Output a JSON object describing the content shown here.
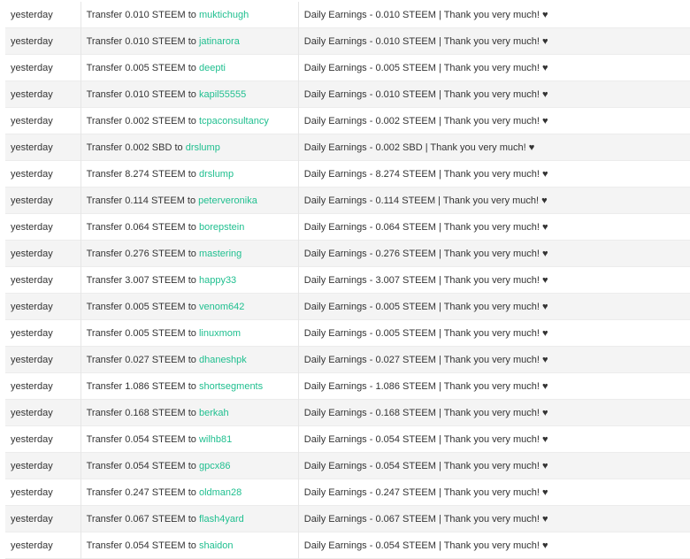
{
  "transfers": [
    {
      "when": "yesterday",
      "op_prefix": "Transfer 0.010 STEEM to",
      "to": "muktichugh",
      "memo": "Daily Earnings - 0.010 STEEM | Thank you very much! ♥"
    },
    {
      "when": "yesterday",
      "op_prefix": "Transfer 0.010 STEEM to",
      "to": "jatinarora",
      "memo": "Daily Earnings - 0.010 STEEM | Thank you very much! ♥"
    },
    {
      "when": "yesterday",
      "op_prefix": "Transfer 0.005 STEEM to",
      "to": "deepti",
      "memo": "Daily Earnings - 0.005 STEEM | Thank you very much! ♥"
    },
    {
      "when": "yesterday",
      "op_prefix": "Transfer 0.010 STEEM to",
      "to": "kapil55555",
      "memo": "Daily Earnings - 0.010 STEEM | Thank you very much! ♥"
    },
    {
      "when": "yesterday",
      "op_prefix": "Transfer 0.002 STEEM to",
      "to": "tcpaconsultancy",
      "memo": "Daily Earnings - 0.002 STEEM | Thank you very much! ♥"
    },
    {
      "when": "yesterday",
      "op_prefix": "Transfer 0.002 SBD to",
      "to": "drslump",
      "memo": "Daily Earnings - 0.002 SBD | Thank you very much! ♥"
    },
    {
      "when": "yesterday",
      "op_prefix": "Transfer 8.274 STEEM to",
      "to": "drslump",
      "memo": "Daily Earnings - 8.274 STEEM | Thank you very much! ♥"
    },
    {
      "when": "yesterday",
      "op_prefix": "Transfer 0.114 STEEM to",
      "to": "peterveronika",
      "memo": "Daily Earnings - 0.114 STEEM | Thank you very much! ♥"
    },
    {
      "when": "yesterday",
      "op_prefix": "Transfer 0.064 STEEM to",
      "to": "borepstein",
      "memo": "Daily Earnings - 0.064 STEEM | Thank you very much! ♥"
    },
    {
      "when": "yesterday",
      "op_prefix": "Transfer 0.276 STEEM to",
      "to": "mastering",
      "memo": "Daily Earnings - 0.276 STEEM | Thank you very much! ♥"
    },
    {
      "when": "yesterday",
      "op_prefix": "Transfer 3.007 STEEM to",
      "to": "happy33",
      "memo": "Daily Earnings - 3.007 STEEM | Thank you very much! ♥"
    },
    {
      "when": "yesterday",
      "op_prefix": "Transfer 0.005 STEEM to",
      "to": "venom642",
      "memo": "Daily Earnings - 0.005 STEEM | Thank you very much! ♥"
    },
    {
      "when": "yesterday",
      "op_prefix": "Transfer 0.005 STEEM to",
      "to": "linuxmom",
      "memo": "Daily Earnings - 0.005 STEEM | Thank you very much! ♥"
    },
    {
      "when": "yesterday",
      "op_prefix": "Transfer 0.027 STEEM to",
      "to": "dhaneshpk",
      "memo": "Daily Earnings - 0.027 STEEM | Thank you very much! ♥"
    },
    {
      "when": "yesterday",
      "op_prefix": "Transfer 1.086 STEEM to",
      "to": "shortsegments",
      "memo": "Daily Earnings - 1.086 STEEM | Thank you very much! ♥"
    },
    {
      "when": "yesterday",
      "op_prefix": "Transfer 0.168 STEEM to",
      "to": "berkah",
      "memo": "Daily Earnings - 0.168 STEEM | Thank you very much! ♥"
    },
    {
      "when": "yesterday",
      "op_prefix": "Transfer 0.054 STEEM to",
      "to": "wilhb81",
      "memo": "Daily Earnings - 0.054 STEEM | Thank you very much! ♥"
    },
    {
      "when": "yesterday",
      "op_prefix": "Transfer 0.054 STEEM to",
      "to": "gpcx86",
      "memo": "Daily Earnings - 0.054 STEEM | Thank you very much! ♥"
    },
    {
      "when": "yesterday",
      "op_prefix": "Transfer 0.247 STEEM to",
      "to": "oldman28",
      "memo": "Daily Earnings - 0.247 STEEM | Thank you very much! ♥"
    },
    {
      "when": "yesterday",
      "op_prefix": "Transfer 0.067 STEEM to",
      "to": "flash4yard",
      "memo": "Daily Earnings - 0.067 STEEM | Thank you very much! ♥"
    },
    {
      "when": "yesterday",
      "op_prefix": "Transfer 0.054 STEEM to",
      "to": "shaidon",
      "memo": "Daily Earnings - 0.054 STEEM | Thank you very much! ♥"
    }
  ],
  "colors": {
    "link": "#1fbf8f",
    "text": "#333333",
    "row_alt": "#f4f4f4"
  }
}
